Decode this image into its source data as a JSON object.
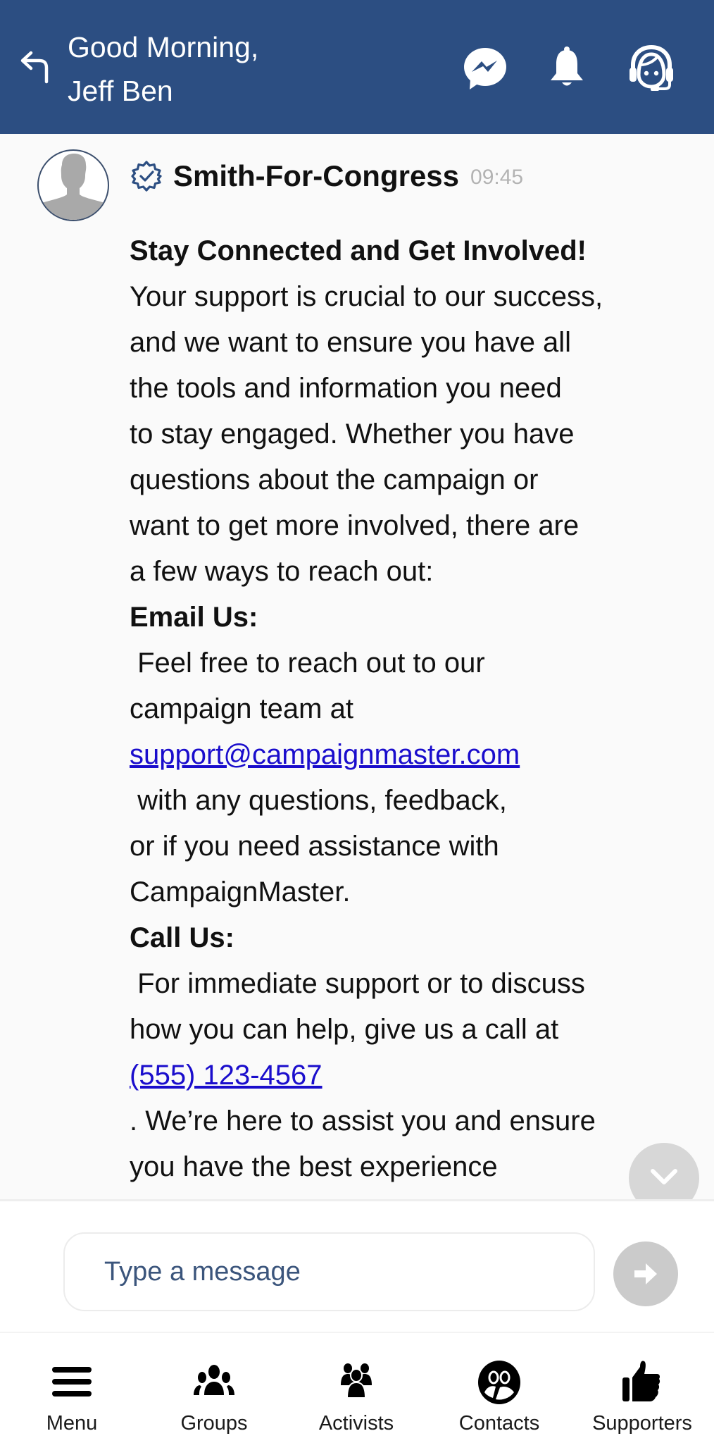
{
  "header": {
    "greeting_line1": "Good Morning,",
    "greeting_line2": "Jeff Ben",
    "icons": [
      "back-arrow-icon",
      "messenger-icon",
      "bell-icon",
      "support-agent-icon"
    ],
    "background_color": "#2c4e82"
  },
  "message": {
    "sender": "Smith-For-Congress",
    "time": "09:45",
    "verified": true,
    "lines": [
      {
        "text": "Stay Connected and Get Involved!",
        "style": "bold"
      },
      {
        "text": "Your support is crucial to our success,"
      },
      {
        "text": "and we want to ensure you have all"
      },
      {
        "text": "the tools and information you need"
      },
      {
        "text": "to stay engaged. Whether you have"
      },
      {
        "text": "questions about the campaign or"
      },
      {
        "text": "want to get more involved, there are"
      },
      {
        "text": "a few ways to reach out:"
      },
      {
        "text": "Email Us:",
        "style": "bold"
      },
      {
        "text": " Feel free to reach out to our"
      },
      {
        "text": "campaign team at"
      },
      {
        "text": "support@campaignmaster.com",
        "style": "link"
      },
      {
        "text": " with any questions, feedback,"
      },
      {
        "text": "or if you need assistance with"
      },
      {
        "text": "CampaignMaster."
      },
      {
        "text": "Call Us:",
        "style": "bold"
      },
      {
        "text": " For immediate support or to discuss"
      },
      {
        "text": "how you can help, give us a call at"
      },
      {
        "text": "(555) 123-4567",
        "style": "link"
      },
      {
        "text": ". We’re here to assist you and ensure"
      },
      {
        "text": "you have the best experience"
      }
    ],
    "link_color": "#1a0dcc"
  },
  "composer": {
    "placeholder": "Type a message",
    "value": ""
  },
  "bottom_nav": {
    "items": [
      {
        "label": "Menu",
        "icon": "menu-icon"
      },
      {
        "label": "Groups",
        "icon": "groups-icon"
      },
      {
        "label": "Activists",
        "icon": "activists-icon"
      },
      {
        "label": "Contacts",
        "icon": "contacts-icon"
      },
      {
        "label": "Supporters",
        "icon": "thumbs-up-icon"
      }
    ]
  }
}
